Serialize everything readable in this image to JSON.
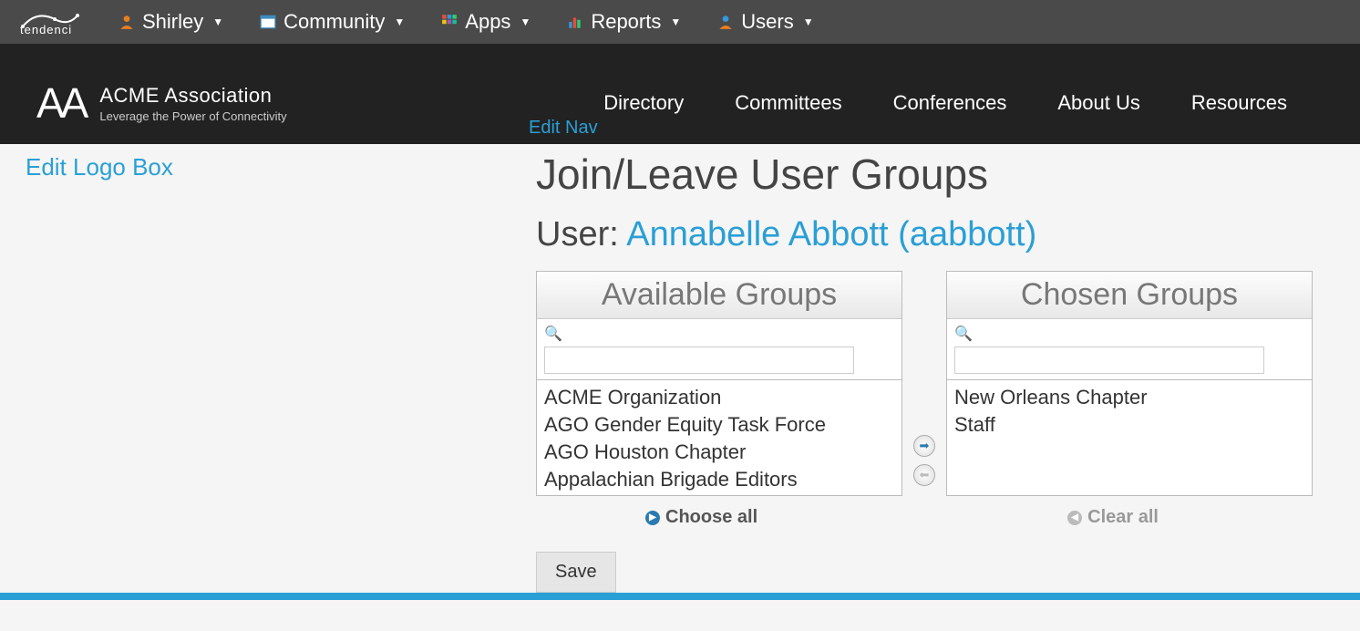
{
  "admin_bar": {
    "brand": "tendenci",
    "items": [
      {
        "label": "Shirley",
        "icon": "user-orange-icon"
      },
      {
        "label": "Community",
        "icon": "window-icon"
      },
      {
        "label": "Apps",
        "icon": "grid-icon"
      },
      {
        "label": "Reports",
        "icon": "chart-icon"
      },
      {
        "label": "Users",
        "icon": "user-blue-icon"
      }
    ]
  },
  "org": {
    "logo_text": "AA",
    "name": "ACME Association",
    "tagline": "Leverage the Power of Connectivity",
    "nav": [
      "Directory",
      "Committees",
      "Conferences",
      "About Us",
      "Resources"
    ],
    "edit_nav": "Edit Nav",
    "edit_logo": "Edit Logo Box"
  },
  "page": {
    "title": "Join/Leave User Groups",
    "user_prefix": "User: ",
    "user_name": "Annabelle Abbott (aabbott)"
  },
  "selector": {
    "available": {
      "header": "Available Groups",
      "filter_placeholder": "",
      "items": [
        "ACME Organization",
        "AGO Gender Equity Task Force",
        "AGO Houston Chapter",
        "Appalachian Brigade Editors"
      ]
    },
    "chosen": {
      "header": "Chosen Groups",
      "filter_placeholder": "",
      "items": [
        "New Orleans Chapter",
        "Staff"
      ]
    },
    "choose_all": "Choose all",
    "clear_all": "Clear all"
  },
  "buttons": {
    "save": "Save"
  }
}
